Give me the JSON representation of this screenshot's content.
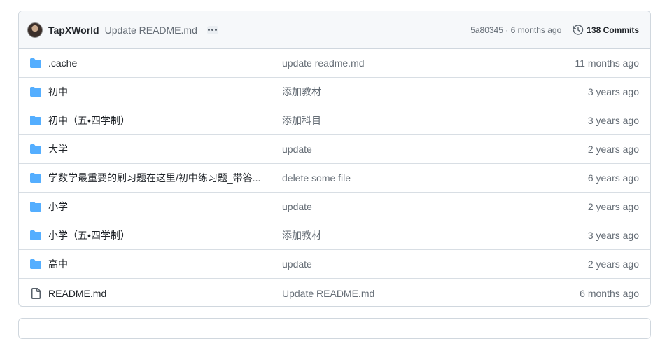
{
  "latest_commit": {
    "author": "TapXWorld",
    "message": "Update README.md",
    "sha_and_time": "5a80345 · 6 months ago",
    "commits_label": "138 Commits"
  },
  "files": [
    {
      "type": "folder",
      "name": ".cache",
      "commit": "update readme.md",
      "age": "11 months ago"
    },
    {
      "type": "folder",
      "name": "初中",
      "commit": "添加教材",
      "age": "3 years ago"
    },
    {
      "type": "folder",
      "name": "初中（五•四学制）",
      "commit": "添加科目",
      "age": "3 years ago"
    },
    {
      "type": "folder",
      "name": "大学",
      "commit": "update",
      "age": "2 years ago"
    },
    {
      "type": "folder",
      "name": "学数学最重要的刷习题在这里/初中练习题_带答...",
      "commit": "delete some file",
      "age": "6 years ago"
    },
    {
      "type": "folder",
      "name": "小学",
      "commit": "update",
      "age": "2 years ago"
    },
    {
      "type": "folder",
      "name": "小学（五•四学制）",
      "commit": "添加教材",
      "age": "3 years ago"
    },
    {
      "type": "folder",
      "name": "高中",
      "commit": "update",
      "age": "2 years ago"
    },
    {
      "type": "file",
      "name": "README.md",
      "commit": "Update README.md",
      "age": "6 months ago"
    }
  ],
  "colors": {
    "folder": "#54aeff",
    "file_icon": "#57606a",
    "muted_text": "#656d76",
    "border": "#d0d7de"
  },
  "icons": {
    "folder": "folder-icon",
    "file": "file-icon",
    "history": "history-icon",
    "ellipsis": "ellipsis-icon"
  }
}
